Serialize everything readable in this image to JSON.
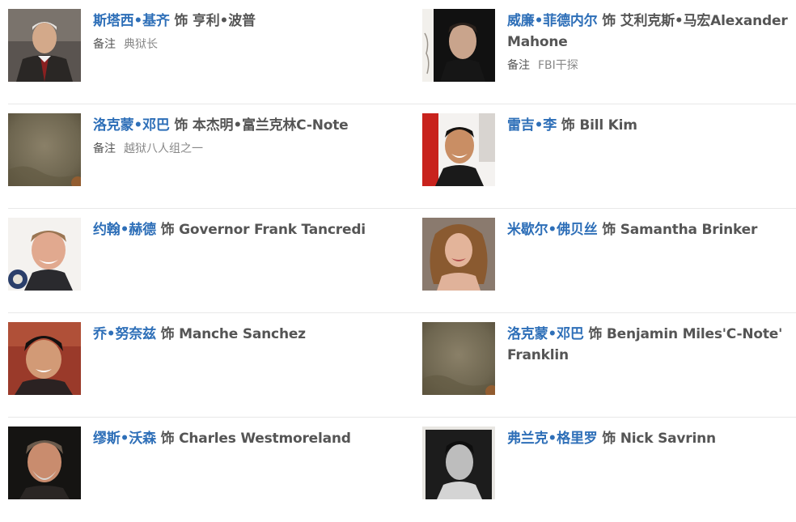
{
  "cast": {
    "as_word": "饰",
    "note_label": "备注",
    "rows": [
      {
        "left": {
          "actor": "斯塔西•基齐",
          "role": "亨利•波普",
          "note": "典狱长",
          "photo": "photo-stacy-keach"
        },
        "right": {
          "actor": "威廉•菲德内尔",
          "role": "艾利克斯•马宏Alexander Mahone",
          "note": "FBI干探",
          "photo": "photo-william-fichtner"
        }
      },
      {
        "left": {
          "actor": "洛克蒙•邓巴",
          "role": "本杰明•富兰克林C-Note",
          "note": "越狱八人组之一",
          "photo": "photo-rockmond-dunbar"
        },
        "right": {
          "actor": "雷吉•李",
          "role": "Bill Kim",
          "note": "",
          "photo": "photo-reggie-lee"
        }
      },
      {
        "left": {
          "actor": "约翰•赫德",
          "role": "Governor Frank Tancredi",
          "note": "",
          "photo": "photo-john-heard"
        },
        "right": {
          "actor": "米歇尔•佛贝丝",
          "role": "Samantha Brinker",
          "note": "",
          "photo": "photo-michelle-forbes"
        }
      },
      {
        "left": {
          "actor": "乔•努奈兹",
          "role": "Manche Sanchez",
          "note": "",
          "photo": "photo-joe-nunez"
        },
        "right": {
          "actor": "洛克蒙•邓巴",
          "role": "Benjamin Miles'C-Note' Franklin",
          "note": "",
          "photo": "photo-rockmond-dunbar-2"
        }
      },
      {
        "left": {
          "actor": "缪斯•沃森",
          "role": "Charles Westmoreland",
          "note": "",
          "photo": "photo-muse-watson"
        },
        "right": {
          "actor": "弗兰克•格里罗",
          "role": "Nick Savrinn",
          "note": "",
          "photo": "photo-frank-grillo"
        }
      }
    ]
  }
}
